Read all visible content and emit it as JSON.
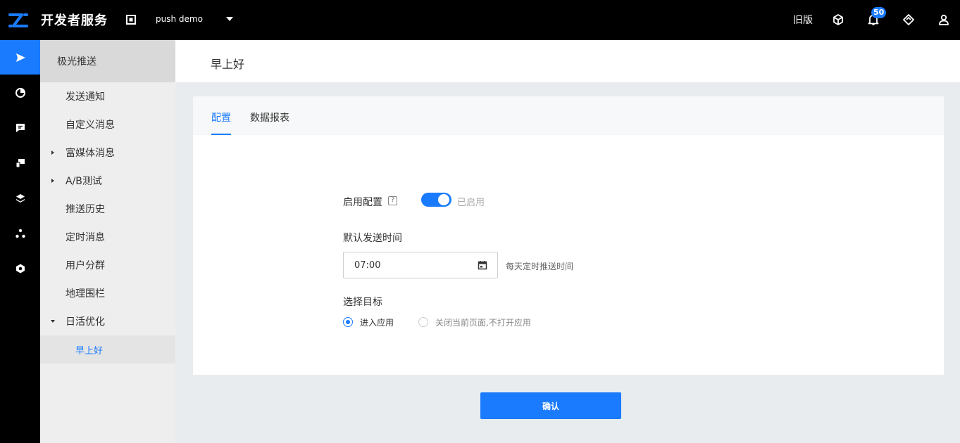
{
  "header": {
    "brand": "开发者服务",
    "app_name": "push demo",
    "old_version": "旧版",
    "notification_count": "50",
    "icons": [
      "cube-icon",
      "bell-icon",
      "diamond-icon",
      "user-icon"
    ]
  },
  "rail": {
    "items": [
      "send-icon",
      "chart-pie-icon",
      "message-icon",
      "devices-icon",
      "layers-icon",
      "nodes-icon",
      "hexagon-settings-icon"
    ],
    "active_index": 0
  },
  "subnav": {
    "title": "极光推送",
    "items": [
      {
        "label": "发送通知"
      },
      {
        "label": "自定义消息"
      },
      {
        "label": "富媒体消息"
      },
      {
        "label": "A/B测试"
      },
      {
        "label": "推送历史"
      },
      {
        "label": "定时消息"
      },
      {
        "label": "用户分群"
      },
      {
        "label": "地理围栏"
      },
      {
        "label": "日活优化"
      }
    ],
    "sub_item": "早上好"
  },
  "page": {
    "title": "早上好",
    "tabs": [
      {
        "label": "配置",
        "active": true
      },
      {
        "label": "数据报表",
        "active": false
      }
    ]
  },
  "form": {
    "enable_label": "启用配置",
    "help": "?",
    "enable_status": "已启用",
    "send_time_label": "默认发送时间",
    "send_time_value": "07:00",
    "send_time_hint": "每天定时推送时间",
    "target_label": "选择目标",
    "target_options": [
      {
        "label": "进入应用",
        "checked": true
      },
      {
        "label": "关闭当前页面,不打开应用",
        "checked": false
      }
    ]
  },
  "actions": {
    "confirm": "确认"
  },
  "colors": {
    "accent": "#1a7bff",
    "topbar": "#000000"
  }
}
